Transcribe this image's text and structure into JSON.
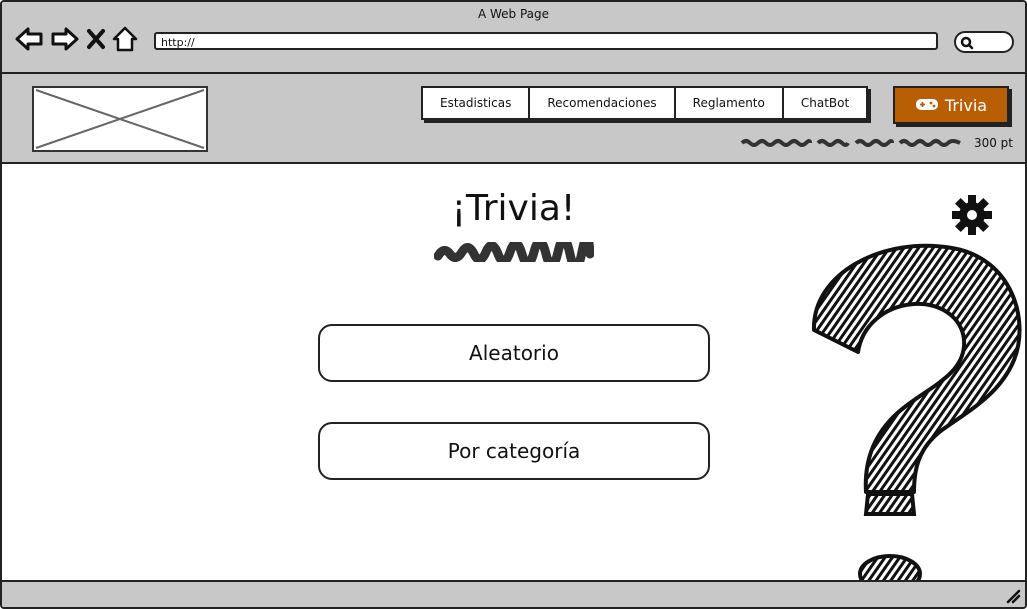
{
  "window": {
    "title": "A Web Page"
  },
  "browser": {
    "url": "http://"
  },
  "header": {
    "nav": [
      {
        "label": "Estadisticas"
      },
      {
        "label": "Recomendaciones"
      },
      {
        "label": "Reglamento"
      },
      {
        "label": "ChatBot"
      }
    ],
    "trivia_button": {
      "label": "Trivia",
      "icon": "gamepad-icon",
      "color": "#b85f05"
    },
    "points": "300 pt"
  },
  "main": {
    "title": "¡Trivia!",
    "options": [
      {
        "label": "Aleatorio"
      },
      {
        "label": "Por categoría"
      }
    ]
  },
  "colors": {
    "chrome": "#c8c8c8",
    "accent": "#b85f05"
  }
}
